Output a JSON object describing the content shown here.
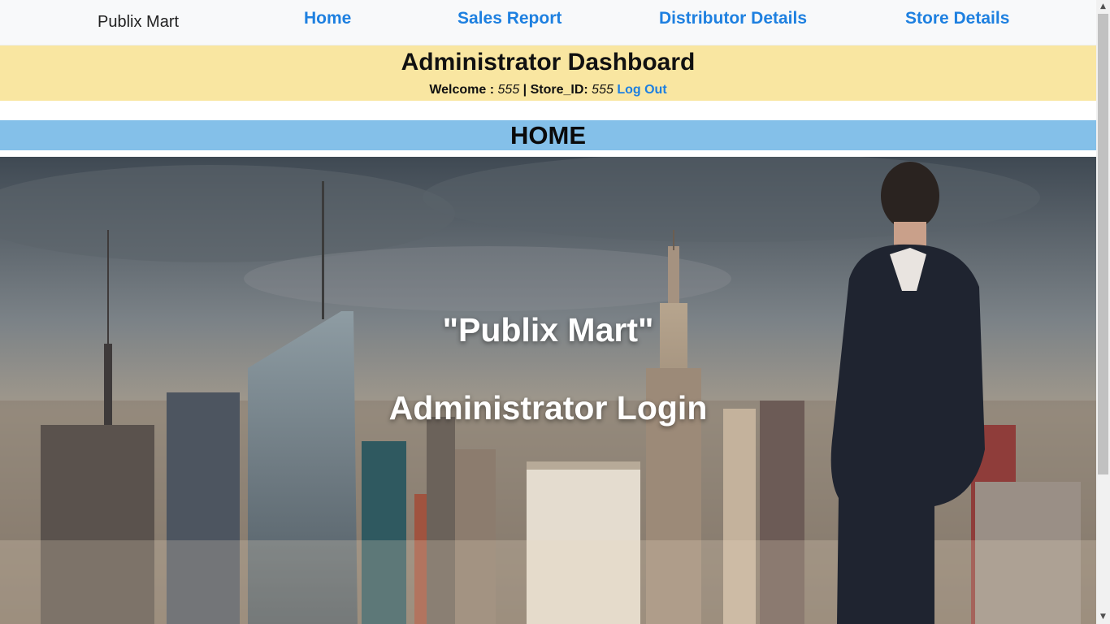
{
  "navbar": {
    "brand": "Publix Mart",
    "links": [
      {
        "label": "Home"
      },
      {
        "label": "Sales Report"
      },
      {
        "label": "Distributor Details"
      },
      {
        "label": "Store Details"
      }
    ]
  },
  "dashboard": {
    "title": "Administrator Dashboard",
    "welcome_label": "Welcome : ",
    "user_value": "555",
    "separator": " | ",
    "store_label": "Store_ID: ",
    "store_value": "555",
    "logout_label": "Log Out"
  },
  "section": {
    "title": "HOME"
  },
  "hero": {
    "line1": "\"Publix Mart\"",
    "line2": "Administrator Login",
    "image": "city-skyline-businessman-photo"
  },
  "colors": {
    "link": "#1e80e0",
    "dashboard_bg": "#f9e6a1",
    "section_bg": "#84c0e9",
    "navbar_bg": "#f8f9fa"
  },
  "icons": {
    "scroll_up": "up-arrow-icon",
    "scroll_down": "down-arrow-icon"
  }
}
